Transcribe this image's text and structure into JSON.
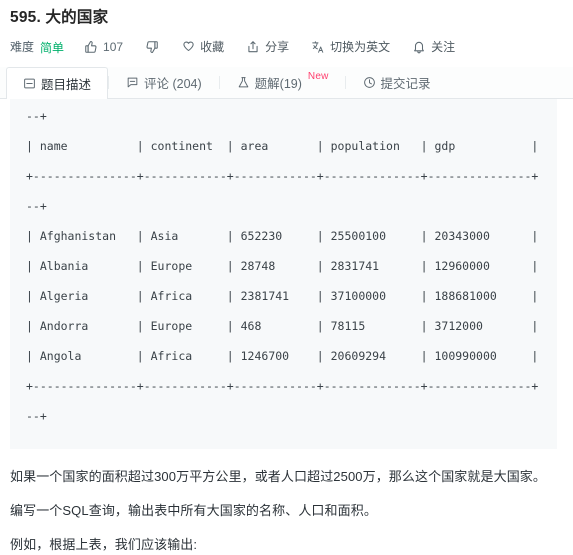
{
  "problem": {
    "title": "595. 大的国家"
  },
  "actions": {
    "difficulty_label": "难度",
    "difficulty_value": "简单",
    "like_count": "107",
    "favorite_label": "收藏",
    "share_label": "分享",
    "translate_label": "切换为英文",
    "follow_label": "关注"
  },
  "tabs": [
    {
      "label": "题目描述",
      "icon": "description-icon",
      "active": true,
      "badge": ""
    },
    {
      "label": "评论 (204)",
      "icon": "comment-icon",
      "active": false,
      "badge": ""
    },
    {
      "label": "题解(19)",
      "icon": "flask-icon",
      "active": false,
      "badge": "New"
    },
    {
      "label": "提交记录",
      "icon": "clock-icon",
      "active": false,
      "badge": ""
    }
  ],
  "code_block": {
    "lines": [
      "+---------------+------------+------------+--------------+---------------+",
      "--+",
      "| name          | continent  | area       | population   | gdp           |",
      "+---------------+------------+------------+--------------+---------------+",
      "--+",
      "| Afghanistan   | Asia       | 652230     | 25500100     | 20343000      |",
      "| Albania       | Europe     | 28748      | 2831741      | 12960000      |",
      "| Algeria       | Africa     | 2381741    | 37100000     | 188681000     |",
      "| Andorra       | Europe     | 468        | 78115        | 3712000       |",
      "| Angola        | Africa     | 1246700    | 20609294     | 100990000     |",
      "+---------------+------------+------------+--------------+---------------+",
      "--+"
    ]
  },
  "description": {
    "paragraph1": "如果一个国家的面积超过300万平方公里，或者人口超过2500万，那么这个国家就是大国家。",
    "paragraph2": "编写一个SQL查询，输出表中所有大国家的名称、人口和面积。",
    "paragraph3": "例如，根据上表，我们应该输出:"
  },
  "colors": {
    "difficulty_green": "#00b06b",
    "badge_pink": "#ff3f6e",
    "code_bg": "#f7f9fa",
    "text": "#2b3238"
  }
}
